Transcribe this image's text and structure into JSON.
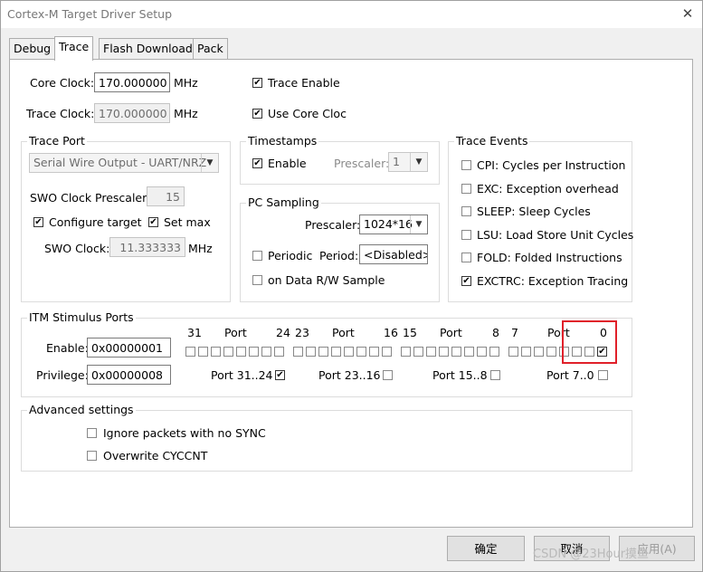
{
  "window": {
    "title": "Cortex-M Target Driver Setup",
    "close_glyph": "✕"
  },
  "tabs": [
    "Debug",
    "Trace",
    "Flash Download",
    "Pack"
  ],
  "clocks": {
    "core_label": "Core Clock:",
    "core_value": "170.000000",
    "core_unit": "MHz",
    "trace_label": "Trace Clock:",
    "trace_value": "170.000000",
    "trace_unit": "MHz"
  },
  "trace_enable": {
    "label": "Trace Enable",
    "checked": true
  },
  "use_core_clock": {
    "label": "Use Core Clock",
    "checked": true
  },
  "trace_port": {
    "title": "Trace Port",
    "mode": "Serial Wire Output - UART/NRZ",
    "prescaler_label": "SWO Clock Prescaler:",
    "prescaler_value": "15",
    "configure_target": "Configure target",
    "set_max": "Set max",
    "swo_clock_label": "SWO Clock:",
    "swo_clock_value": "11.333333",
    "swo_clock_unit": "MHz"
  },
  "timestamps": {
    "title": "Timestamps",
    "enable_label": "Enable",
    "prescaler_label": "Prescaler:",
    "prescaler_value": "1"
  },
  "pc_sampling": {
    "title": "PC Sampling",
    "prescaler_label": "Prescaler:",
    "prescaler_value": "1024*16",
    "periodic_label": "Periodic",
    "period_label": "Period:",
    "period_value": "<Disabled>",
    "data_rw_label": "on Data R/W Sample"
  },
  "trace_events": {
    "title": "Trace Events",
    "items": [
      {
        "label": "CPI: Cycles per Instruction",
        "checked": false
      },
      {
        "label": "EXC: Exception overhead",
        "checked": false
      },
      {
        "label": "SLEEP: Sleep Cycles",
        "checked": false
      },
      {
        "label": "LSU: Load Store Unit Cycles",
        "checked": false
      },
      {
        "label": "FOLD: Folded Instructions",
        "checked": false
      },
      {
        "label": "EXCTRC: Exception Tracing",
        "checked": true
      }
    ]
  },
  "itm": {
    "title": "ITM Stimulus Ports",
    "enable_label": "Enable:",
    "enable_value": "0x00000001",
    "privilege_label": "Privilege:",
    "privilege_value": "0x00000008",
    "header": [
      "31",
      "Port",
      "24",
      "23",
      "Port",
      "16",
      "15",
      "Port",
      "8",
      "7",
      "Port",
      "0"
    ],
    "port_groups": [
      "Port 31..24",
      "Port 23..16",
      "Port 15..8",
      "Port 7..0"
    ],
    "port0_enabled": true
  },
  "advanced": {
    "title": "Advanced settings",
    "ignore_sync": "Ignore packets with no SYNC",
    "overwrite_cyccnt": "Overwrite CYCCNT"
  },
  "buttons": {
    "ok": "确定",
    "cancel": "取消",
    "apply": "应用(A)"
  },
  "watermark": "CSDN @23Hour摸鱼",
  "glyphs": {
    "check": "✔",
    "dropdown": "▼"
  }
}
